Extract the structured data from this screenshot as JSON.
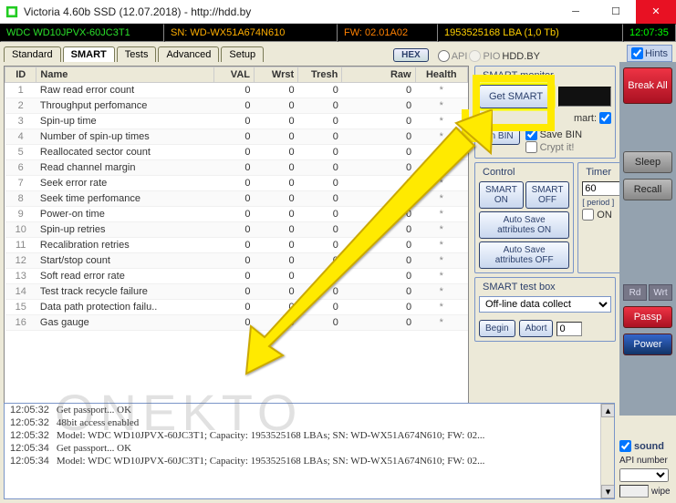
{
  "window": {
    "title": "Victoria 4.60b SSD (12.07.2018) - http://hdd.by"
  },
  "blackbar": {
    "model": "WDC WD10JPVX-60JC3T1",
    "sn": "SN: WD-WX51A674N610",
    "fw": "FW: 02.01A02",
    "lba": "1953525168 LBA (1,0 Tb)",
    "clock": "12:07:35"
  },
  "tabs": {
    "standard": "Standard",
    "smart": "SMART",
    "tests": "Tests",
    "advanced": "Advanced",
    "setup": "Setup"
  },
  "toolbar": {
    "hex": "HEX",
    "api": "API",
    "pio": "PIO",
    "hddby": "HDD.BY",
    "hints": "Hints"
  },
  "table": {
    "headers": {
      "id": "ID",
      "name": "Name",
      "val": "VAL",
      "wrst": "Wrst",
      "tresh": "Tresh",
      "raw": "Raw",
      "health": "Health"
    },
    "rows": [
      {
        "id": "1",
        "name": "Raw read error count",
        "val": "0",
        "wrst": "0",
        "tresh": "0",
        "raw": "0",
        "health": "*"
      },
      {
        "id": "2",
        "name": "Throughput perfomance",
        "val": "0",
        "wrst": "0",
        "tresh": "0",
        "raw": "0",
        "health": "*"
      },
      {
        "id": "3",
        "name": "Spin-up time",
        "val": "0",
        "wrst": "0",
        "tresh": "0",
        "raw": "0",
        "health": "*"
      },
      {
        "id": "4",
        "name": "Number of spin-up times",
        "val": "0",
        "wrst": "0",
        "tresh": "0",
        "raw": "0",
        "health": "*"
      },
      {
        "id": "5",
        "name": "Reallocated sector count",
        "val": "0",
        "wrst": "0",
        "tresh": "0",
        "raw": "0",
        "health": "*"
      },
      {
        "id": "6",
        "name": "Read channel margin",
        "val": "0",
        "wrst": "0",
        "tresh": "0",
        "raw": "0",
        "health": "*"
      },
      {
        "id": "7",
        "name": "Seek error rate",
        "val": "0",
        "wrst": "0",
        "tresh": "0",
        "raw": "0",
        "health": "*"
      },
      {
        "id": "8",
        "name": "Seek time perfomance",
        "val": "0",
        "wrst": "0",
        "tresh": "0",
        "raw": "0",
        "health": "*"
      },
      {
        "id": "9",
        "name": "Power-on time",
        "val": "0",
        "wrst": "0",
        "tresh": "0",
        "raw": "0",
        "health": "*"
      },
      {
        "id": "10",
        "name": "Spin-up retries",
        "val": "0",
        "wrst": "0",
        "tresh": "0",
        "raw": "0",
        "health": "*"
      },
      {
        "id": "11",
        "name": "Recalibration retries",
        "val": "0",
        "wrst": "0",
        "tresh": "0",
        "raw": "0",
        "health": "*"
      },
      {
        "id": "12",
        "name": "Start/stop count",
        "val": "0",
        "wrst": "0",
        "tresh": "0",
        "raw": "0",
        "health": "*"
      },
      {
        "id": "13",
        "name": "Soft read error rate",
        "val": "0",
        "wrst": "0",
        "tresh": "0",
        "raw": "0",
        "health": "*"
      },
      {
        "id": "14",
        "name": "Test track recycle failure",
        "val": "0",
        "wrst": "0",
        "tresh": "0",
        "raw": "0",
        "health": "*"
      },
      {
        "id": "15",
        "name": "Data path protection failu..",
        "val": "0",
        "wrst": "0",
        "tresh": "0",
        "raw": "0",
        "health": "*"
      },
      {
        "id": "16",
        "name": "Gas gauge",
        "val": "0",
        "wrst": "0",
        "tresh": "0",
        "raw": "0",
        "health": "*"
      }
    ]
  },
  "smartmon": {
    "legend": "SMART monitor",
    "get_smart": "Get SMART",
    "usb_label": "mart:",
    "open_bin": "en BIN",
    "save_bin": "Save BIN",
    "crypt_it": "Crypt it!"
  },
  "control": {
    "legend": "Control",
    "smart_on": "SMART ON",
    "smart_off": "SMART OFF",
    "autosave_on": "Auto Save attributes ON",
    "autosave_off": "Auto Save attributes OFF"
  },
  "timer": {
    "legend": "Timer",
    "value": "60",
    "period": "[ period ]",
    "on": "ON"
  },
  "testbox": {
    "legend": "SMART test box",
    "select_value": "Off-line data collect",
    "begin": "Begin",
    "abort": "Abort",
    "count": "0"
  },
  "far": {
    "break_all": "Break All",
    "sleep": "Sleep",
    "recall": "Recall",
    "rd": "Rd",
    "wrt": "Wrt",
    "passp": "Passp",
    "power": "Power",
    "sound": "sound",
    "api_number": "API number",
    "wipe": "wipe"
  },
  "log": [
    {
      "ts": "12:05:32",
      "msg": "Get passport... OK"
    },
    {
      "ts": "12:05:32",
      "msg": "48bit access enabled"
    },
    {
      "ts": "12:05:32",
      "msg": "Model: WDC WD10JPVX-60JC3T1; Capacity: 1953525168 LBAs; SN: WD-WX51A674N610; FW: 02..."
    },
    {
      "ts": "12:05:34",
      "msg": "Get passport... OK"
    },
    {
      "ts": "12:05:34",
      "msg": "Model: WDC WD10JPVX-60JC3T1; Capacity: 1953525168 LBAs; SN: WD-WX51A674N610; FW: 02..."
    }
  ],
  "watermark": "ONEKTO"
}
